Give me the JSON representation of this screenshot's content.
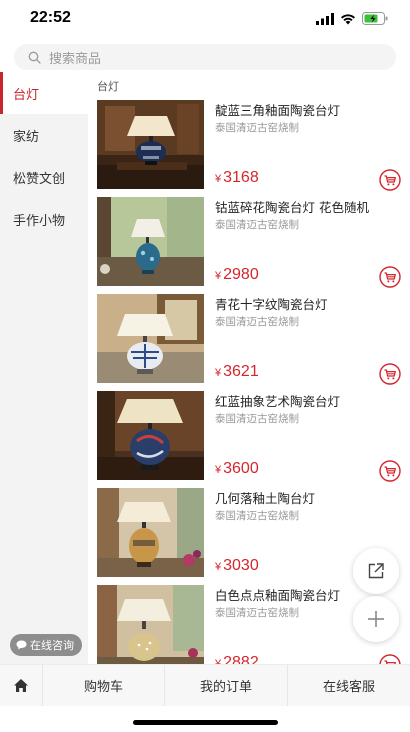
{
  "status": {
    "time": "22:52"
  },
  "search": {
    "placeholder": "搜索商品"
  },
  "sidebar": {
    "items": [
      {
        "label": "台灯",
        "active": true
      },
      {
        "label": "家纺",
        "active": false
      },
      {
        "label": "松赞文创",
        "active": false
      },
      {
        "label": "手作小物",
        "active": false
      }
    ],
    "consult_label": "在线咨询"
  },
  "content": {
    "category_title": "台灯",
    "currency": "¥",
    "products": [
      {
        "name": "靛蓝三角釉面陶瓷台灯",
        "subtitle": "泰国清迈古窑烧制",
        "price": "3168"
      },
      {
        "name": "钴蓝碎花陶瓷台灯 花色随机",
        "subtitle": "泰国清迈古窑烧制",
        "price": "2980"
      },
      {
        "name": "青花十字纹陶瓷台灯",
        "subtitle": "泰国清迈古窑烧制",
        "price": "3621"
      },
      {
        "name": "红蓝抽象艺术陶瓷台灯",
        "subtitle": "泰国清迈古窑烧制",
        "price": "3600"
      },
      {
        "name": "几何落釉土陶台灯",
        "subtitle": "泰国清迈古窑烧制",
        "price": "3030"
      },
      {
        "name": "白色点点釉面陶瓷台灯",
        "subtitle": "泰国清迈古窑烧制",
        "price": "2882"
      }
    ]
  },
  "bottom_nav": {
    "cart": "购物车",
    "orders": "我的订单",
    "service": "在线客服"
  },
  "colors": {
    "accent": "#c8252c",
    "price": "#d4262c"
  },
  "icons": [
    "search-icon",
    "home-icon",
    "cart-icon",
    "share-icon",
    "plus-icon",
    "chat-icon",
    "signal-icon",
    "wifi-icon",
    "battery-icon"
  ]
}
